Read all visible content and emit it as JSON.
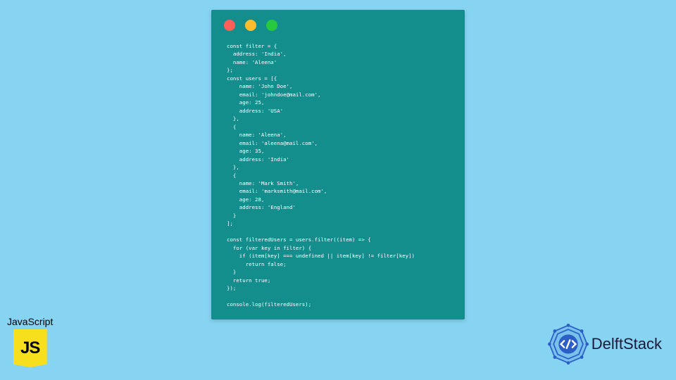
{
  "background_color": "#87d3f2",
  "code_window": {
    "bg": "#148d8d",
    "traffic_lights": [
      "#ff5f56",
      "#ffbd2e",
      "#27c93f"
    ],
    "code": "const filter = {\n  address: 'India',\n  name: 'Aleena'\n};\nconst users = [{\n    name: 'John Doe',\n    email: 'johndoe@mail.com',\n    age: 25,\n    address: 'USA'\n  },\n  {\n    name: 'Aleena',\n    email: 'aleena@mail.com',\n    age: 35,\n    address: 'India'\n  },\n  {\n    name: 'Mark Smith',\n    email: 'marksmith@mail.com',\n    age: 28,\n    address: 'England'\n  }\n];\n\nconst filteredUsers = users.filter((item) => {\n  for (var key in filter) {\n    if (item[key] === undefined || item[key] != filter[key])\n      return false;\n  }\n  return true;\n});\n\nconsole.log(filteredUsers);"
  },
  "js_badge": {
    "label": "JavaScript",
    "icon_text": "JS",
    "icon_bg": "#f7df1e"
  },
  "brand": {
    "name": "DelftStack",
    "logo_color": "#2b5fc7"
  }
}
